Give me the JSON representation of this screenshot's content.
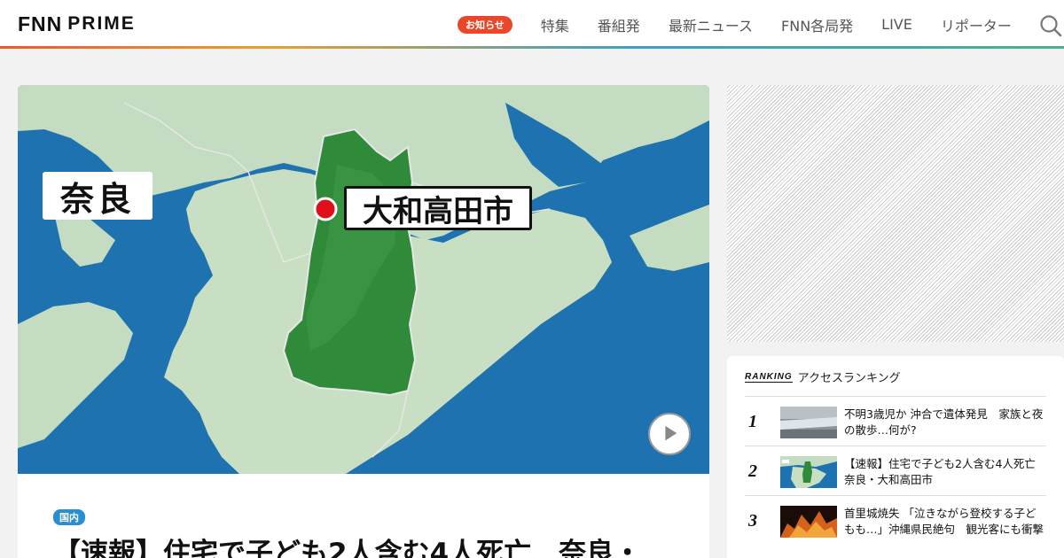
{
  "header": {
    "logo_fnn": "FNN",
    "logo_prime": "PRIME",
    "notice_badge": "お知らせ",
    "nav": [
      "特集",
      "番組発",
      "最新ニュース",
      "FNN各局発",
      "LIVE",
      "リポーター"
    ],
    "search_icon": "search-icon",
    "accent_colors": [
      "#e85a2c",
      "#e8a02c",
      "#3aa0c8",
      "#4bb08a"
    ]
  },
  "article": {
    "map": {
      "prefecture_label": "奈良",
      "city_label": "大和高田市",
      "marker_color": "#e0101a",
      "sea_color": "#1f72b0",
      "highlight_color": "#2f8a3a"
    },
    "category": "国内",
    "title": "【速報】住宅で子ども2人含む4人死亡　奈良・"
  },
  "ranking": {
    "logo": "RANKING",
    "title": "アクセスランキング",
    "items": [
      {
        "rank": "1",
        "text": "不明3歳児か 沖合で遺体発見　家族と夜の散歩…何が?"
      },
      {
        "rank": "2",
        "text": "【速報】住宅で子ども2人含む4人死亡　奈良・大和高田市"
      },
      {
        "rank": "3",
        "text": "首里城焼失 「泣きながら登校する子どもも…」沖縄県民絶句　観光客にも衝撃"
      }
    ]
  }
}
